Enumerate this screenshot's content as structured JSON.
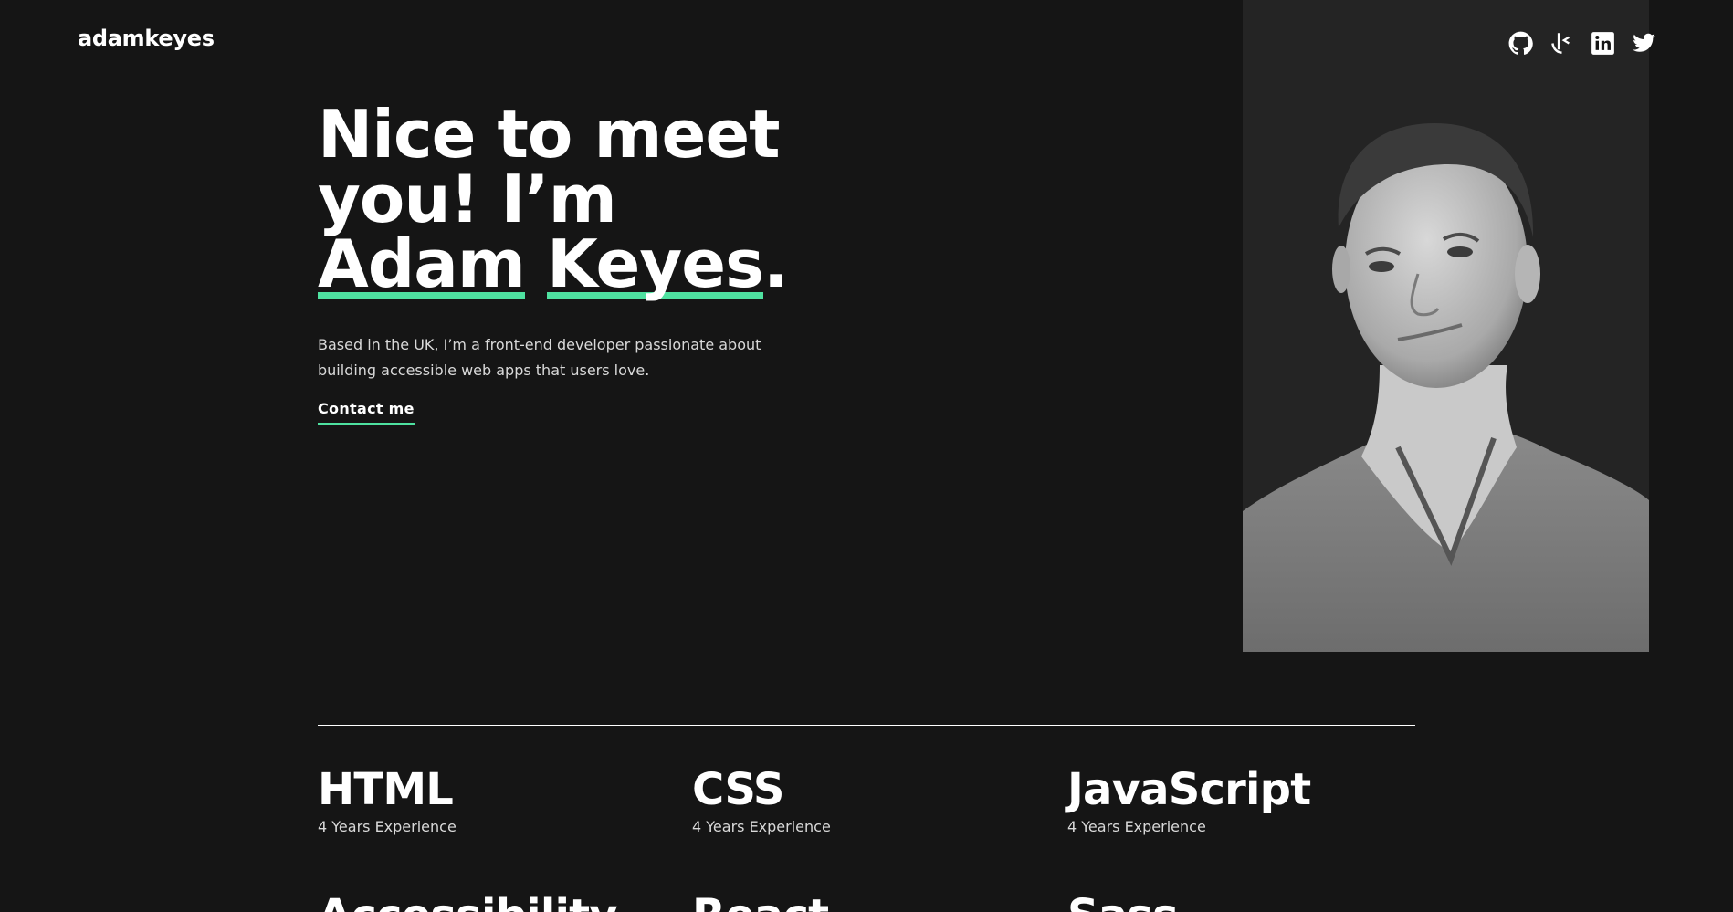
{
  "header": {
    "logo": "adamkeyes"
  },
  "social": [
    {
      "icon": "github-icon"
    },
    {
      "icon": "frontend-mentor-icon"
    },
    {
      "icon": "linkedin-icon"
    },
    {
      "icon": "twitter-icon"
    }
  ],
  "hero": {
    "title_part1": "Nice to meet you! I’m ",
    "title_name1": "Adam",
    "title_name2": "Keyes",
    "title_end": ".",
    "description": "Based in the UK, I’m a front-end developer passionate about building accessible web apps that users love.",
    "contact_label": "Contact me"
  },
  "skills": [
    {
      "name": "HTML",
      "experience": "4 Years Experience"
    },
    {
      "name": "CSS",
      "experience": "4 Years Experience"
    },
    {
      "name": "JavaScript",
      "experience": "4 Years Experience"
    },
    {
      "name": "Accessibility",
      "experience": ""
    },
    {
      "name": "React",
      "experience": ""
    },
    {
      "name": "Sass",
      "experience": ""
    }
  ],
  "colors": {
    "background": "#151515",
    "panel": "#242424",
    "accent": "#4ee1a0",
    "text": "#ffffff",
    "muted": "#d9d9d9"
  }
}
